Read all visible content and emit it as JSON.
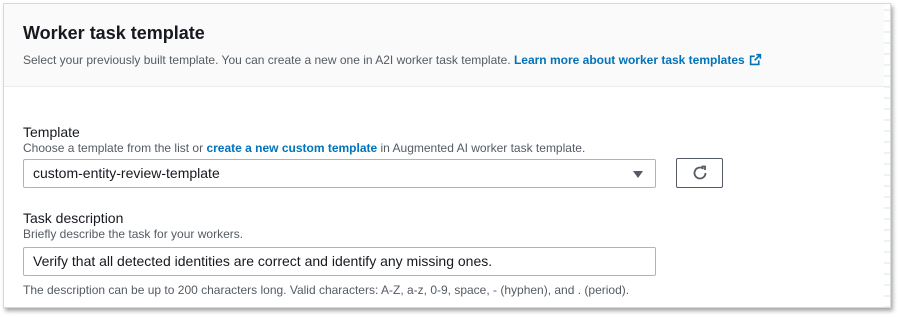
{
  "header": {
    "title": "Worker task template",
    "description": "Select your previously built template. You can create a new one in A2I worker task template.",
    "learn_more_link": "Learn more about worker task templates"
  },
  "template_field": {
    "label": "Template",
    "hint_before": "Choose a template from the list or",
    "hint_link": "create a new custom template",
    "hint_after": "in Augmented AI worker task template.",
    "selected_value": "custom-entity-review-template"
  },
  "task_description_field": {
    "label": "Task description",
    "hint": "Briefly describe the task for your workers.",
    "value": "Verify that all detected identities are correct and identify any missing ones.",
    "constraint": "The description can be up to 200 characters long. Valid characters: A-Z, a-z, 0-9, space, - (hyphen), and . (period)."
  },
  "icons": {
    "external_link": "external-link-icon",
    "refresh": "refresh-icon",
    "dropdown": "caret-down-icon"
  },
  "colors": {
    "link": "#0073bb",
    "header_bg": "#fafafa",
    "border": "#aab7b8"
  }
}
